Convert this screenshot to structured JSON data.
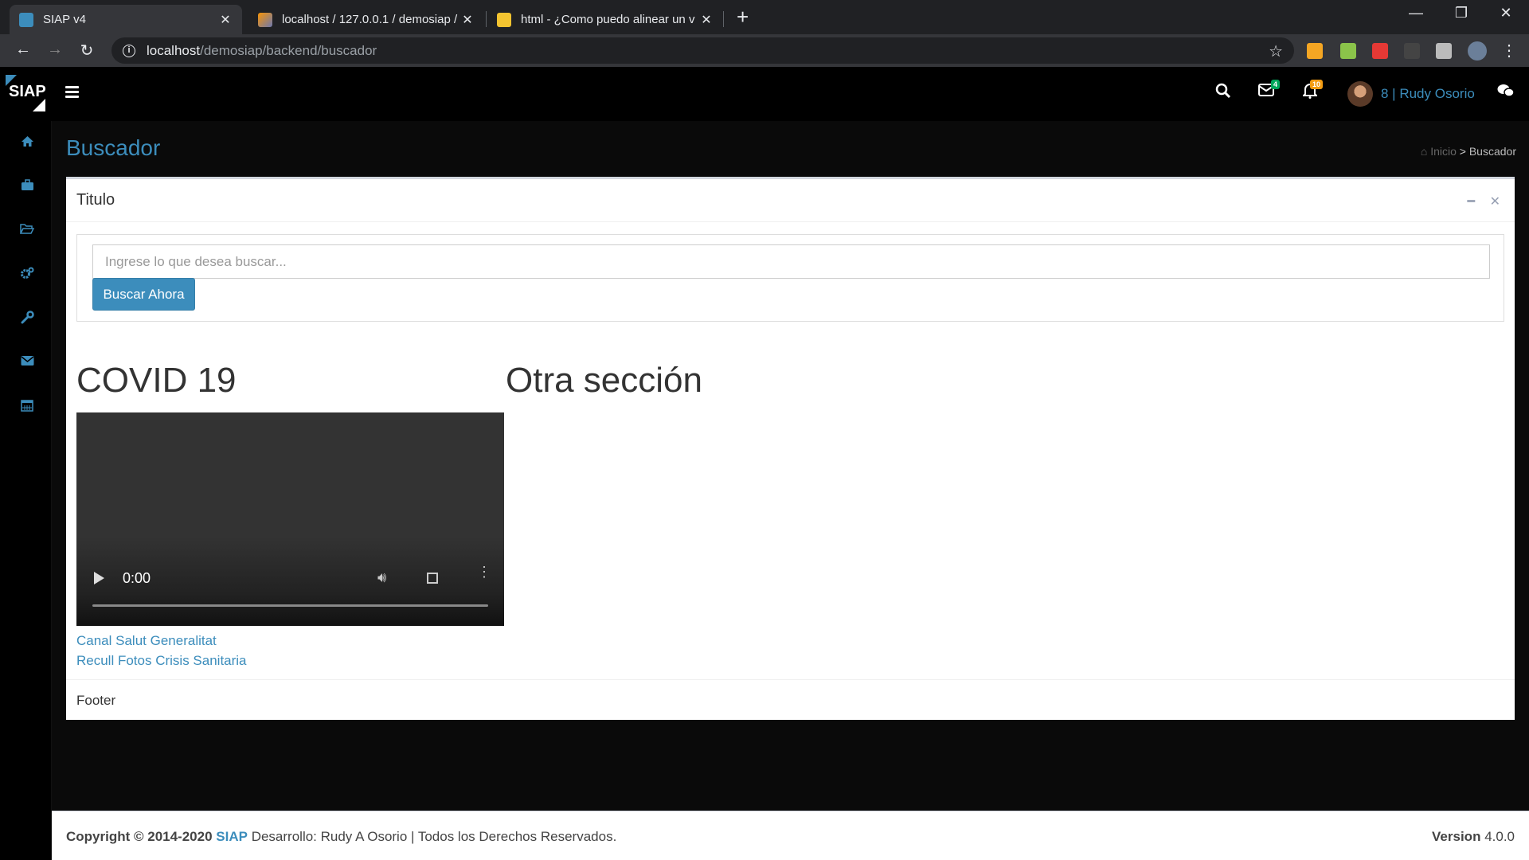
{
  "browser": {
    "tabs": [
      {
        "title": "SIAP v4",
        "close": "✕"
      },
      {
        "title": "localhost / 127.0.0.1 / demosiap /",
        "close": "✕"
      },
      {
        "title": "html - ¿Como puedo alinear un v",
        "close": "✕"
      }
    ],
    "new_tab": "+",
    "url_host": "localhost",
    "url_path": "/demosiap/backend/buscador",
    "window_controls": {
      "minimize": "—",
      "restore": "❐",
      "close": "✕"
    }
  },
  "header": {
    "logo": "SIAP",
    "messages_count": "4",
    "notifications_count": "10",
    "user": "8 | Rudy Osorio"
  },
  "sidebar": {
    "icons": [
      "home-icon",
      "briefcase-icon",
      "folder-icon",
      "cogs-icon",
      "wrench-icon",
      "envelope-icon",
      "calendar-icon"
    ]
  },
  "page": {
    "title": "Buscador",
    "breadcrumb_home": "Inicio",
    "breadcrumb_sep": ">",
    "breadcrumb_current": "Buscador"
  },
  "box": {
    "title": "Titulo",
    "search_placeholder": "Ingrese lo que desea buscar...",
    "search_button": "Buscar Ahora",
    "section1_title": "COVID 19",
    "section2_title": "Otra sección",
    "video_time": "0:00",
    "links": [
      "Canal Salut Generalitat",
      "Recull Fotos Crisis Sanitaria"
    ],
    "footer": "Footer"
  },
  "footer": {
    "copyright": "Copyright © 2014-2020",
    "brand": "SIAP",
    "text": "Desarrollo: Rudy A Osorio | Todos los Derechos Reservados.",
    "version_label": "Version",
    "version": "4.0.0"
  },
  "colors": {
    "accent": "#3c8dbc",
    "msg_badge": "#00a65a",
    "notif_badge": "#f39c12"
  }
}
